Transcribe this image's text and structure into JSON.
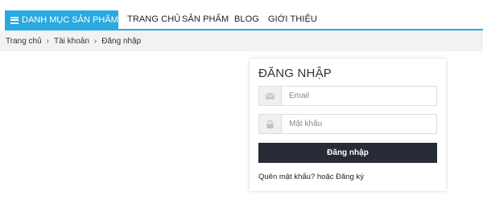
{
  "nav": {
    "category_label": "DANH MỤC SẢN PHẨM",
    "items": [
      {
        "label": "TRANG CHỦ"
      },
      {
        "label": "SẢN PHẨM"
      },
      {
        "label": "BLOG"
      },
      {
        "label": "GIỚI THIỆU"
      }
    ],
    "accent_color": "#2aa9e0"
  },
  "breadcrumb": {
    "items": [
      "Trang chủ",
      "Tài khoản",
      "Đăng nhập"
    ],
    "separator": "›"
  },
  "login": {
    "title": "ĐĂNG NHẬP",
    "email_placeholder": "Email",
    "password_placeholder": "Mật khẩu",
    "submit_label": "Đăng nhập",
    "forgot_label": "Quên mật khẩu?",
    "or_label": "hoặc",
    "register_label": "Đăng ký",
    "email_icon": "envelope-icon",
    "password_icon": "lock-icon",
    "button_color": "#262b36"
  }
}
